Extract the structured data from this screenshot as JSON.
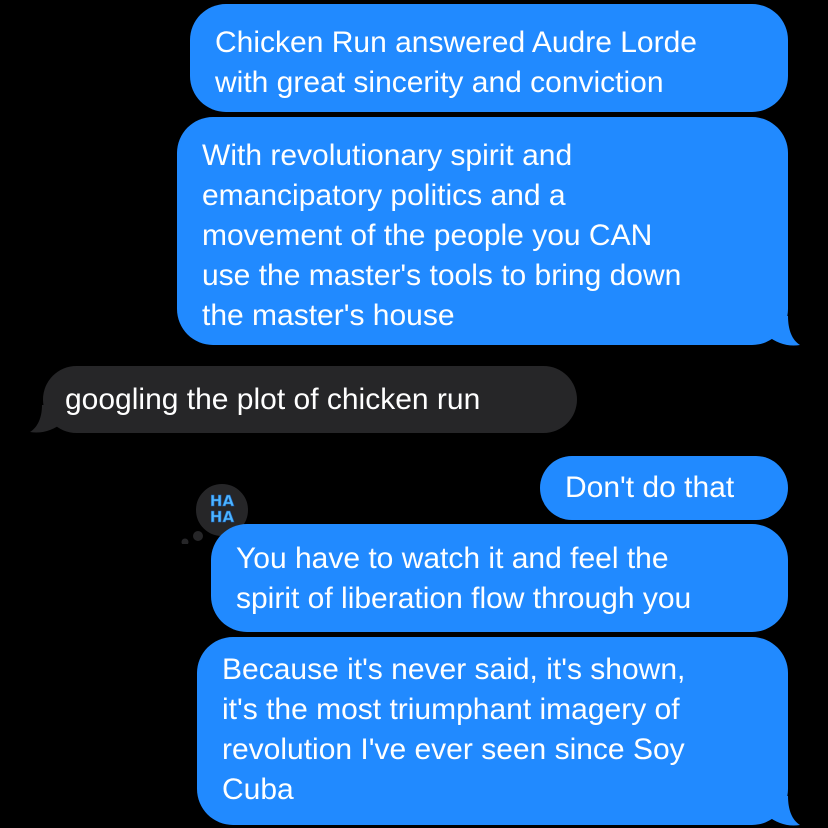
{
  "conversation": {
    "messages": [
      {
        "direction": "sent",
        "lines": [
          "Chicken Run answered Audre Lorde",
          "with great sincerity and conviction"
        ]
      },
      {
        "direction": "sent",
        "lines": [
          "With revolutionary spirit and",
          "emancipatory politics and a",
          "movement of the people you CAN",
          "use the master's tools to bring down",
          "the master's house"
        ]
      },
      {
        "direction": "received",
        "lines": [
          "googling the plot of chicken run"
        ]
      },
      {
        "direction": "sent",
        "lines": [
          "Don't do that"
        ]
      },
      {
        "direction": "sent",
        "lines": [
          "You have to watch it and feel the",
          "spirit of liberation flow through you"
        ]
      },
      {
        "direction": "sent",
        "lines": [
          "Because it's never said, it's shown,",
          "it's the most triumphant imagery of",
          "revolution I've ever seen since Soy",
          "Cuba"
        ]
      }
    ],
    "tapback": {
      "icon": "haha-icon",
      "lines": [
        "HA",
        "HA"
      ],
      "accent": "#4fb7ff"
    }
  },
  "colors": {
    "background": "#000000",
    "sent_bubble": "#218aff",
    "received_bubble": "#262628",
    "text": "#ffffff"
  }
}
